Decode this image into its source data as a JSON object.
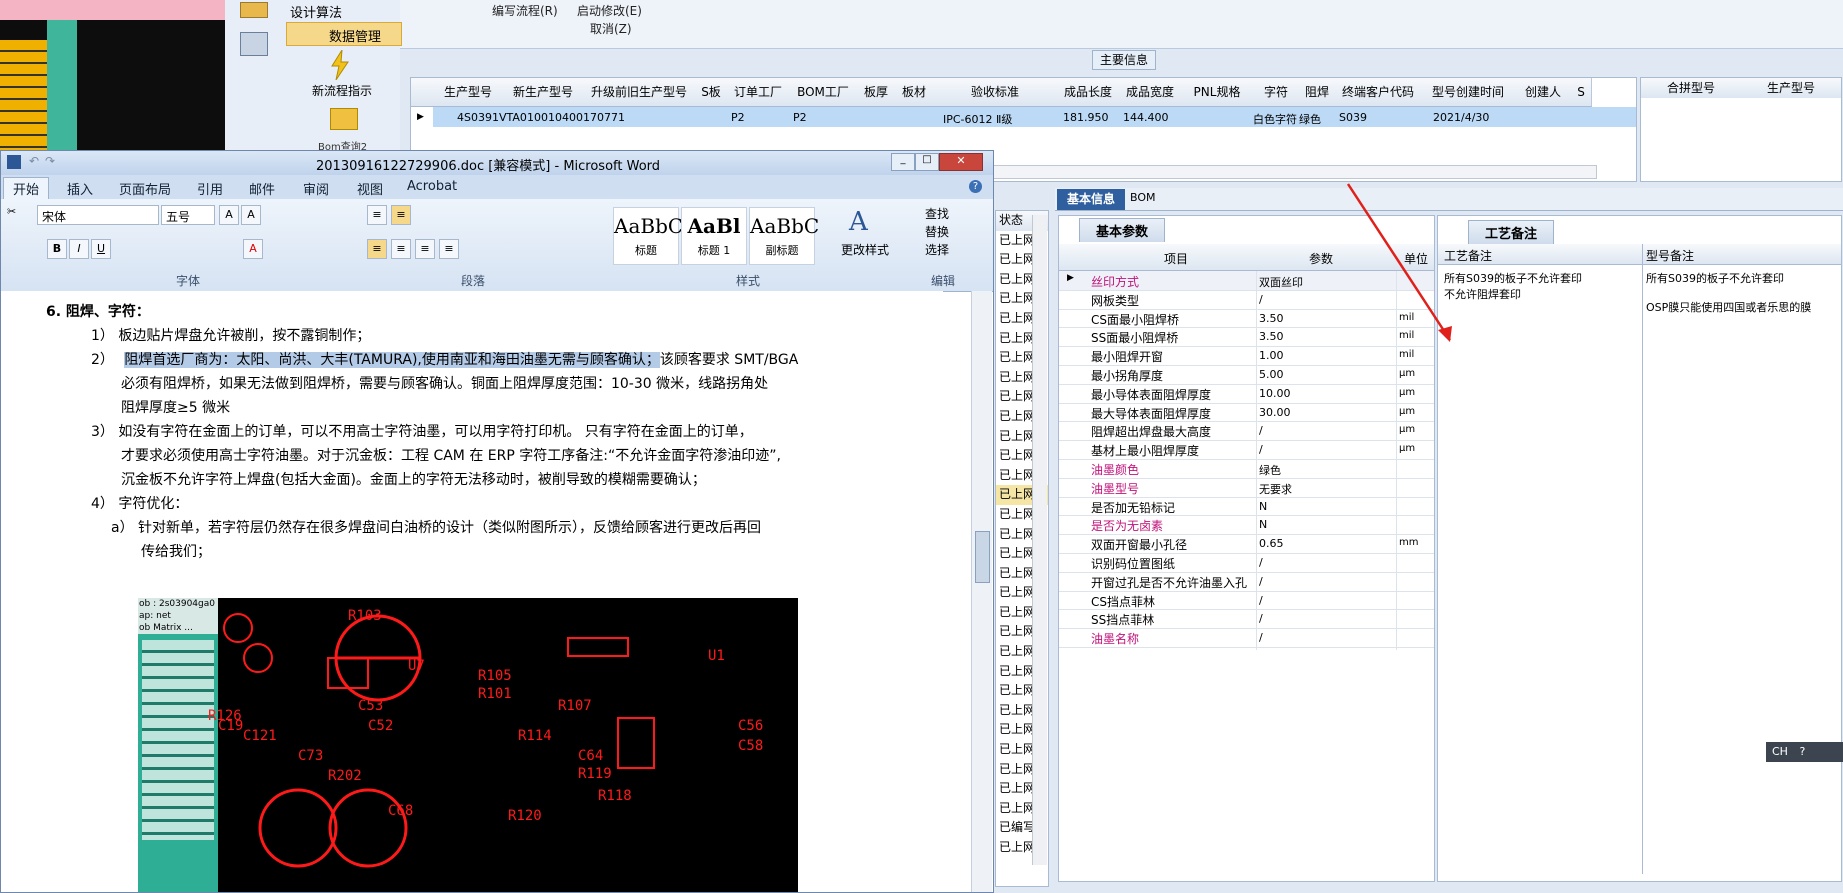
{
  "erp": {
    "menu": [
      "编写流程(R)",
      "启动修改(E)",
      "取消(Z)"
    ],
    "nav": [
      "设计算法",
      "数据管理",
      "新流程指示",
      "Bom查询2"
    ],
    "section_title": "主要信息",
    "grid_headers": [
      "生产型号",
      "新生产型号",
      "升级前旧生产型号",
      "S板",
      "订单工厂",
      "BOM工厂",
      "板厚",
      "板材",
      "验收标准",
      "成品长度",
      "成品宽度",
      "PNL规格",
      "字符",
      "阻焊",
      "终端客户代码",
      "型号创建时间",
      "创建人",
      "S"
    ],
    "grid_row": {
      "model": "4S0391VTA0",
      "new_model": "10010400170771",
      "order_factory": "P2",
      "bom_factory": "P2",
      "standard": "IPC-6012 Ⅱ级",
      "length": "181.950",
      "width": "144.400",
      "char": "白色字符",
      "solder": "绿色",
      "customer": "S039",
      "created": "2021/4/30"
    },
    "grid2_headers": [
      "合拼型号",
      "生产型号"
    ],
    "tabs": [
      "基本信息",
      "BOM"
    ],
    "status_header": "状态",
    "status_items": [
      "已上网",
      "已上网",
      "已上网",
      "已上网",
      "已上网",
      "已上网",
      "已上网",
      "已上网",
      "已上网",
      "已上网",
      "已上网",
      "已上网",
      "已上网",
      "已上网",
      "已上网",
      "已上网",
      "已上网",
      "已上网",
      "已上网",
      "已上网",
      "已上网",
      "已上网",
      "已上网",
      "已上网",
      "已上网",
      "已上网",
      "已上网",
      "已上网",
      "已上网",
      "已上网",
      "已编写",
      "已上网"
    ],
    "params_tab": "基本参数",
    "params_headers": [
      "项目",
      "参数",
      "单位"
    ],
    "params": [
      {
        "name": "丝印方式",
        "value": "双面丝印",
        "unit": "",
        "hl": true
      },
      {
        "name": "网板类型",
        "value": "/",
        "unit": "",
        "hl": false
      },
      {
        "name": "CS面最小阻焊桥",
        "value": "3.50",
        "unit": "mil",
        "hl": false
      },
      {
        "name": "SS面最小阻焊桥",
        "value": "3.50",
        "unit": "mil",
        "hl": false
      },
      {
        "name": "最小阻焊开窗",
        "value": "1.00",
        "unit": "mil",
        "hl": false
      },
      {
        "name": "最小拐角厚度",
        "value": "5.00",
        "unit": "μm",
        "hl": false
      },
      {
        "name": "最小导体表面阻焊厚度",
        "value": "10.00",
        "unit": "μm",
        "hl": false
      },
      {
        "name": "最大导体表面阻焊厚度",
        "value": "30.00",
        "unit": "μm",
        "hl": false
      },
      {
        "name": "阻焊超出焊盘最大高度",
        "value": "/",
        "unit": "μm",
        "hl": false
      },
      {
        "name": "基材上最小阻焊厚度",
        "value": "/",
        "unit": "μm",
        "hl": false
      },
      {
        "name": "油墨颜色",
        "value": "绿色",
        "unit": "",
        "hl": true
      },
      {
        "name": "油墨型号",
        "value": "无要求",
        "unit": "",
        "hl": true
      },
      {
        "name": "是否加无铅标记",
        "value": "N",
        "unit": "",
        "hl": false
      },
      {
        "name": "是否为无卤素",
        "value": "N",
        "unit": "",
        "hl": true
      },
      {
        "name": "双面开窗最小孔径",
        "value": "0.65",
        "unit": "mm",
        "hl": false
      },
      {
        "name": "识别码位置图纸",
        "value": "/",
        "unit": "",
        "hl": false
      },
      {
        "name": "开窗过孔是否不允许油墨入孔",
        "value": "/",
        "unit": "",
        "hl": false
      },
      {
        "name": "CS挡点菲林",
        "value": "/",
        "unit": "",
        "hl": false
      },
      {
        "name": "SS挡点菲林",
        "value": "/",
        "unit": "",
        "hl": false
      },
      {
        "name": "油墨名称",
        "value": "/",
        "unit": "",
        "hl": true
      }
    ],
    "notes_tab": "工艺备注",
    "notes_headers": [
      "工艺备注",
      "型号备注"
    ],
    "process_note": "所有S039的板子不允许套印\n不允许阻焊套印",
    "model_note": "所有S039的板子不允许套印\n\nOSP膜只能使用四国或者乐思的膜",
    "ime": "CH"
  },
  "word": {
    "title": "20130916122729906.doc [兼容模式] - Microsoft Word",
    "tabs": [
      "开始",
      "插入",
      "页面布局",
      "引用",
      "邮件",
      "审阅",
      "视图",
      "Acrobat"
    ],
    "font_name": "宋体",
    "font_size": "五号",
    "groups": [
      "字体",
      "段落",
      "样式",
      "编辑"
    ],
    "styles": [
      {
        "sample": "AaBbC",
        "label": "标题"
      },
      {
        "sample": "AaBl",
        "label": "标题 1"
      },
      {
        "sample": "AaBbC",
        "label": "副标题"
      }
    ],
    "change_style": "更改样式",
    "edit": [
      "查找",
      "替换",
      "选择"
    ],
    "lines": [
      "6.   阻焊、字符：",
      "1） 板边贴片焊盘允许被削，按不露铜制作；",
      "阻焊首选厂商为：太阳、尚洪、大丰(TAMURA),使用南亚和海田油墨无需与顾客确认；",
      "该顾客要求 SMT/BGA",
      "必须有阻焊桥，如果无法做到阻焊桥，需要与顾客确认。铜面上阻焊厚度范围：10-30 微米，线路拐角处",
      "阻焊厚度≥5 微米",
      "3） 如没有字符在金面上的订单，可以不用高士字符油墨，可以用字符打印机。    只有字符在金面上的订单，",
      "才要求必须使用高士字符油墨。对于沉金板：工程 CAM 在 ERP 字符工序备注:“不允许金面字符渗油印迹”,",
      "沉金板不允许字符上焊盘(包括大金面)。金面上的字符无法移动时，被削导致的模糊需要确认；",
      "4） 字符优化：",
      "a） 针对新单，若字符层仍然存在很多焊盘间白油桥的设计（类似附图所示），反馈给顾客进行更改后再回",
      "传给我们；"
    ],
    "item2_prefix": "2）",
    "pcb_labels": [
      "R105",
      "R101",
      "R107",
      "R114",
      "C64",
      "R119",
      "R118",
      "C53",
      "C52",
      "C68",
      "R120",
      "R202",
      "R103",
      "R126",
      "C19",
      "C121",
      "C73",
      "U7",
      "U1",
      "C56",
      "C58"
    ],
    "pcb_panel": [
      "ob : 2s03904ga0",
      "ap: net",
      "ob Matrix ..."
    ]
  }
}
